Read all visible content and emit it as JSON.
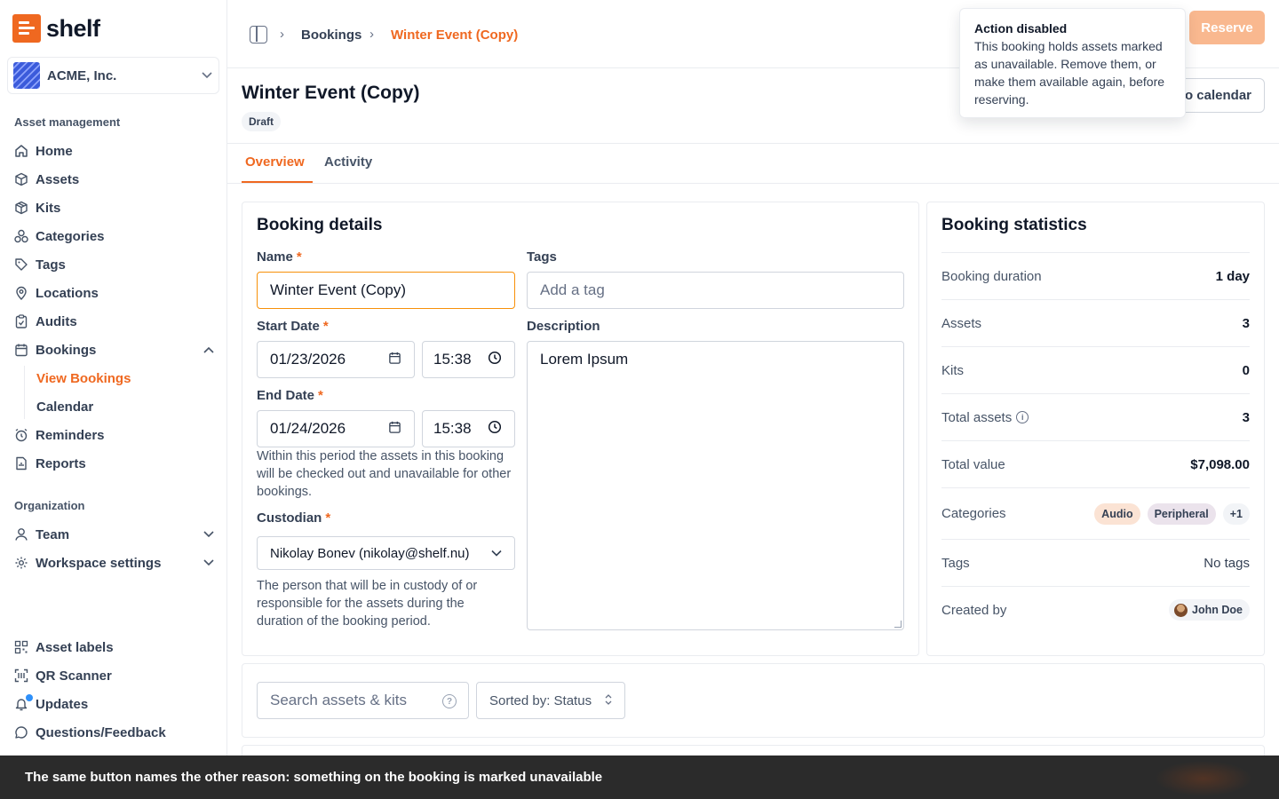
{
  "brand": {
    "name": "shelf"
  },
  "workspace": {
    "name": "ACME, Inc."
  },
  "sidebar": {
    "section_asset": "Asset management",
    "items": [
      {
        "label": "Home",
        "icon": "home-icon"
      },
      {
        "label": "Assets",
        "icon": "cube-icon"
      },
      {
        "label": "Kits",
        "icon": "box-icon"
      },
      {
        "label": "Categories",
        "icon": "shapes-icon"
      },
      {
        "label": "Tags",
        "icon": "tag-icon"
      },
      {
        "label": "Locations",
        "icon": "map-pin-icon"
      },
      {
        "label": "Audits",
        "icon": "clipboard-icon"
      },
      {
        "label": "Bookings",
        "icon": "calendar-icon"
      },
      {
        "label": "Reminders",
        "icon": "alarm-icon"
      },
      {
        "label": "Reports",
        "icon": "report-icon"
      }
    ],
    "bookings_sub": [
      {
        "label": "View Bookings",
        "active": true
      },
      {
        "label": "Calendar",
        "active": false
      }
    ],
    "section_org": "Organization",
    "org_items": [
      {
        "label": "Team",
        "icon": "user-icon"
      },
      {
        "label": "Workspace settings",
        "icon": "gear-icon"
      }
    ],
    "bottom_items": [
      {
        "label": "Asset labels",
        "icon": "qr-icon"
      },
      {
        "label": "QR Scanner",
        "icon": "scan-icon"
      },
      {
        "label": "Updates",
        "icon": "bell-icon"
      },
      {
        "label": "Questions/Feedback",
        "icon": "message-icon"
      }
    ]
  },
  "header": {
    "breadcrumb": [
      "Bookings",
      "Winter Event (Copy)"
    ],
    "reserve_label": "Reserve",
    "calendar_label": "to calendar"
  },
  "tooltip": {
    "title": "Action disabled",
    "text": "This booking holds assets marked as unavailable. Remove them, or make them available again, before reserving."
  },
  "page": {
    "title": "Winter Event (Copy)",
    "status": "Draft"
  },
  "tabs": [
    "Overview",
    "Activity"
  ],
  "details": {
    "title": "Booking details",
    "name_label": "Name",
    "name_value": "Winter Event (Copy)",
    "tags_label": "Tags",
    "tags_placeholder": "Add a tag",
    "start_label": "Start Date",
    "start_date": "01/23/2026",
    "start_time": "15:38",
    "end_label": "End Date",
    "end_date": "01/24/2026",
    "end_time": "15:38",
    "period_help": "Within this period the assets in this booking will be checked out and unavailable for other bookings.",
    "description_label": "Description",
    "description_value": "Lorem Ipsum",
    "custodian_label": "Custodian",
    "custodian_value": "Nikolay Bonev (nikolay@shelf.nu)",
    "custodian_help": "The person that will be in custody of or responsible for the assets during the duration of the booking period."
  },
  "stats": {
    "title": "Booking statistics",
    "rows": [
      {
        "label": "Booking duration",
        "value": "1 day"
      },
      {
        "label": "Assets",
        "value": "3"
      },
      {
        "label": "Kits",
        "value": "0"
      },
      {
        "label": "Total assets",
        "value": "3"
      },
      {
        "label": "Total value",
        "value": "$7,098.00"
      },
      {
        "label": "Categories",
        "value": ""
      },
      {
        "label": "Tags",
        "value": "No tags"
      },
      {
        "label": "Created by",
        "value": ""
      }
    ],
    "categories": [
      {
        "label": "Audio",
        "color": "#fbe3d4"
      },
      {
        "label": "Peripheral",
        "color": "#ebe3ec"
      },
      {
        "label": "+1",
        "color": "#f2f4f7"
      }
    ],
    "created_by": "John Doe"
  },
  "assets_toolbar": {
    "search_placeholder": "Search assets & kits",
    "sort_label": "Sorted by: Status"
  },
  "caption": "The same button names the other reason: something on the booking is marked unavailable",
  "colors": {
    "accent": "#ef6820",
    "accent_disabled": "#f9b88f",
    "caption_bg": "#2b2b2b"
  }
}
